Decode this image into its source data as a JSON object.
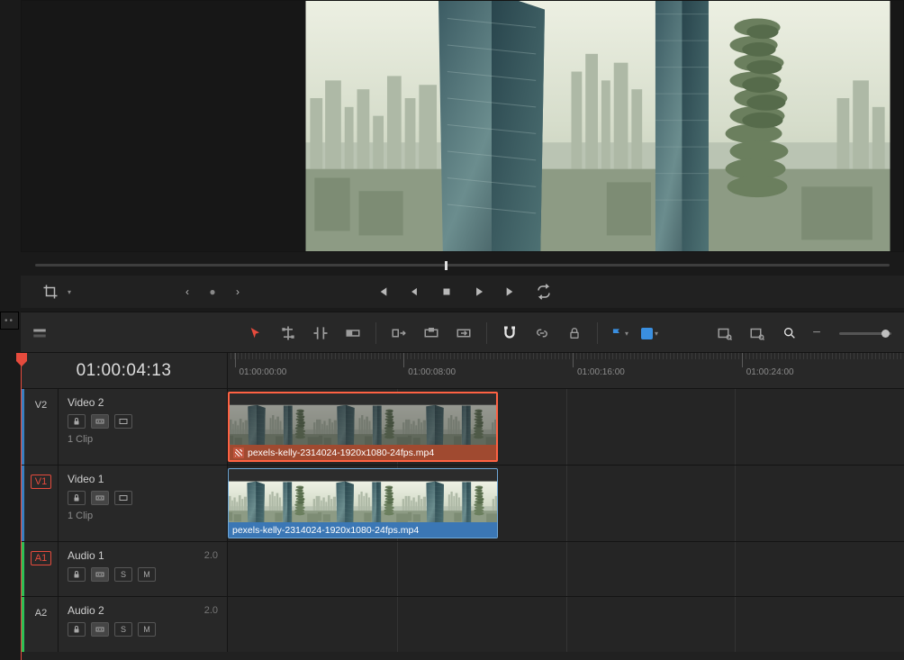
{
  "transport": {
    "jog_position_pct": 48
  },
  "timecode": "01:00:04:13",
  "ruler": {
    "marks": [
      {
        "pct": 1,
        "label": "01:00:00:00"
      },
      {
        "pct": 26,
        "label": "01:00:08:00"
      },
      {
        "pct": 51,
        "label": "01:00:16:00"
      },
      {
        "pct": 76,
        "label": "01:00:24:00"
      }
    ]
  },
  "playhead_pct": 14.3,
  "tracks": {
    "v2": {
      "id": "V2",
      "name": "Video 2",
      "clips_label": "1 Clip",
      "selected": false
    },
    "v1": {
      "id": "V1",
      "name": "Video 1",
      "clips_label": "1 Clip",
      "selected": true
    },
    "a1": {
      "id": "A1",
      "name": "Audio 1",
      "channels": "2.0",
      "selected": true
    },
    "a2": {
      "id": "A2",
      "name": "Audio 2",
      "channels": "2.0",
      "selected": false
    }
  },
  "clips": {
    "v2": {
      "start_pct": 0,
      "width_pct": 40,
      "label": "pexels-kelly-2314024-1920x1080-24fps.mp4",
      "selected": true,
      "has_fx": true
    },
    "v1": {
      "start_pct": 0,
      "width_pct": 40,
      "label": "pexels-kelly-2314024-1920x1080-24fps.mp4",
      "selected": false,
      "has_fx": false
    }
  },
  "icons": {
    "mute": "M",
    "solo": "S"
  },
  "colors": {
    "flag1": "#3a8fe0",
    "flag2": "#3a8fe0"
  }
}
